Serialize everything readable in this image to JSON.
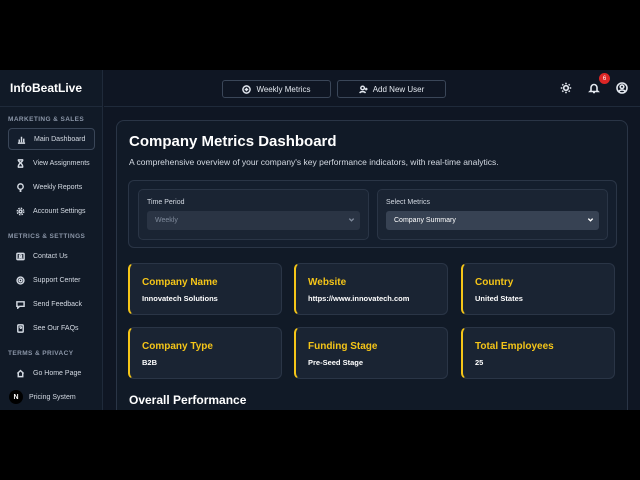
{
  "brand": "InfoBeatLive",
  "sidebar": {
    "sections": [
      {
        "title": "MARKETING & SALES",
        "items": [
          {
            "label": "Main Dashboard",
            "icon": "bar-chart-icon",
            "active": true
          },
          {
            "label": "View Assignments",
            "icon": "hourglass-icon"
          },
          {
            "label": "Weekly Reports",
            "icon": "lightbulb-icon"
          },
          {
            "label": "Account Settings",
            "icon": "gear-icon"
          }
        ]
      },
      {
        "title": "METRICS & SETTINGS",
        "items": [
          {
            "label": "Contact Us",
            "icon": "contact-card-icon"
          },
          {
            "label": "Support Center",
            "icon": "lifebuoy-icon"
          },
          {
            "label": "Send Feedback",
            "icon": "message-icon"
          },
          {
            "label": "See Our FAQs",
            "icon": "faq-document-icon"
          }
        ]
      },
      {
        "title": "TERMS & PRIVACY",
        "items": [
          {
            "label": "Go Home Page",
            "icon": "home-icon"
          },
          {
            "label": "Pricing System",
            "icon": "n-badge-icon",
            "badge": "N"
          }
        ]
      }
    ]
  },
  "topbar": {
    "weekly_metrics": "Weekly Metrics",
    "add_new_user": "Add New User",
    "notification_count": "6"
  },
  "main": {
    "title": "Company Metrics Dashboard",
    "subtitle": "A comprehensive overview of your company's key performance indicators, with real-time analytics.",
    "filters": {
      "time_period_label": "Time Period",
      "time_period_value": "Weekly",
      "select_metrics_label": "Select Metrics",
      "select_metrics_value": "Company Summary"
    },
    "metrics": [
      {
        "label": "Company Name",
        "value": "Innovatech Solutions"
      },
      {
        "label": "Website",
        "value": "https://www.innovatech.com"
      },
      {
        "label": "Country",
        "value": "United States"
      },
      {
        "label": "Company Type",
        "value": "B2B"
      },
      {
        "label": "Funding Stage",
        "value": "Pre-Seed Stage"
      },
      {
        "label": "Total Employees",
        "value": "25"
      }
    ],
    "overall_title": "Overall Performance"
  },
  "colors": {
    "accent": "#f5c518",
    "background": "#0f1623",
    "panel": "#1a2433",
    "badge": "#dc2626"
  }
}
